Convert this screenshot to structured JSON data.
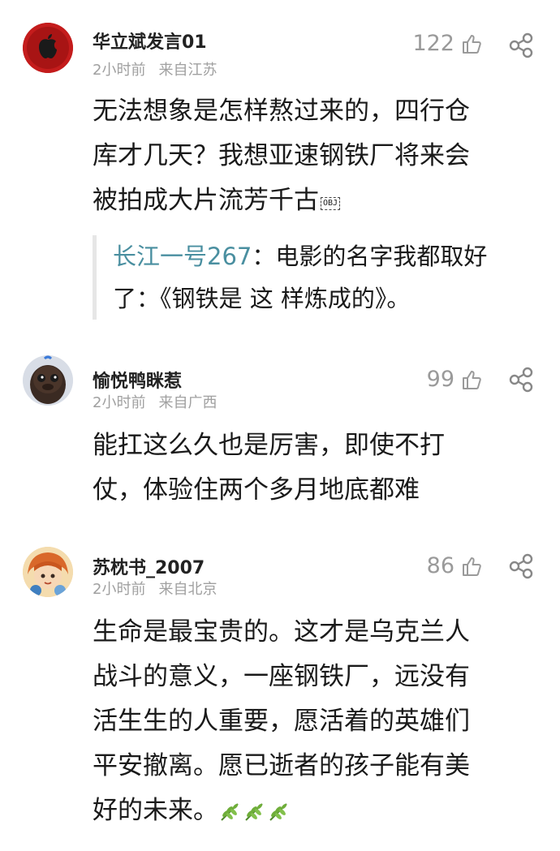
{
  "comments": [
    {
      "username": "华立斌发言01",
      "time": "2小时前",
      "location": "来自江苏",
      "likes": "122",
      "avatar_icon": "apple-logo-avatar",
      "body_lines": [
        "无法想象是怎样熬过来的，四行仓",
        "库才几天？我想亚速钢铁厂将来会",
        "被拍成大片流芳千古"
      ],
      "obj_marker": "OBJ",
      "reply": {
        "name": "长江一号267",
        "separator": "：",
        "line1": "电影的名字我都取好",
        "line2": "了：《钢铁是 这 样炼成的》。"
      }
    },
    {
      "username": "愉悦鸭眯惹",
      "time": "2小时前",
      "location": "来自广西",
      "likes": "99",
      "avatar_icon": "duck-avatar",
      "body_lines": [
        "能扛这么久也是厉害，即使不打",
        "仗，体验住两个多月地底都难"
      ]
    },
    {
      "username": "苏枕书_2007",
      "time": "2小时前",
      "location": "来自北京",
      "likes": "86",
      "avatar_icon": "cartoon-girl-avatar",
      "body_lines": [
        "生命是最宝贵的。这才是乌克兰人",
        "战斗的意义，一座钢铁厂，远没有",
        "活生生的人重要，愿活着的英雄们",
        "平安撤离。愿已逝者的孩子能有美",
        "好的未来。"
      ],
      "emoji": "olive-branch-icon"
    }
  ],
  "colors": {
    "reply_name": "#4a8fa0",
    "meta": "#a0a0a0",
    "olive": "#6fae3a"
  }
}
